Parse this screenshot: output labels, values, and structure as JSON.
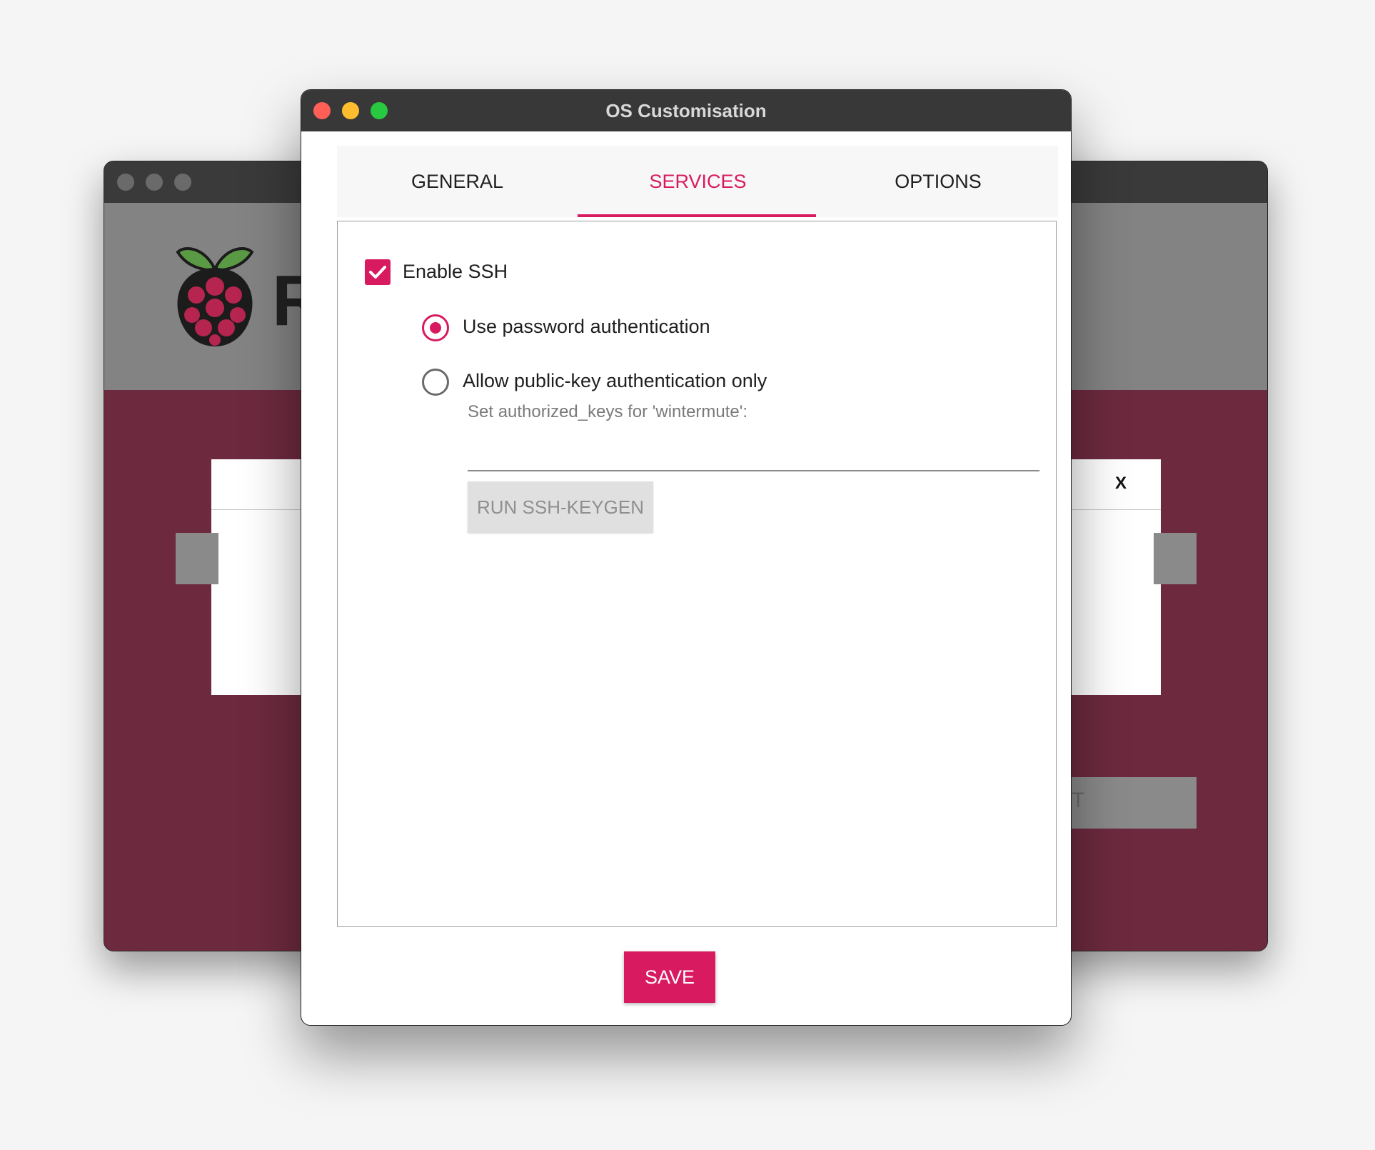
{
  "window": {
    "title": "OS Customisation"
  },
  "tabs": [
    {
      "label": "GENERAL",
      "active": false
    },
    {
      "label": "SERVICES",
      "active": true
    },
    {
      "label": "OPTIONS",
      "active": false
    }
  ],
  "services": {
    "enable_ssh": {
      "label": "Enable SSH",
      "checked": true
    },
    "password_auth": {
      "label": "Use password authentication",
      "selected": true
    },
    "pubkey_auth": {
      "label": "Allow public-key authentication only",
      "selected": false
    },
    "authorized_keys": {
      "label": "Set authorized_keys for 'wintermute':",
      "value": ""
    },
    "keygen_button": "RUN SSH-KEYGEN"
  },
  "save_button": "SAVE",
  "background_window": {
    "dialog_close": "X",
    "logo_letter": "R",
    "button_fragment": "T"
  },
  "colors": {
    "accent": "#d81b60",
    "titlebar": "#383838",
    "bg_window": "#6d2a3f",
    "traffic_close": "#ff5f57",
    "traffic_minimize": "#febc2e",
    "traffic_zoom": "#28c840"
  }
}
